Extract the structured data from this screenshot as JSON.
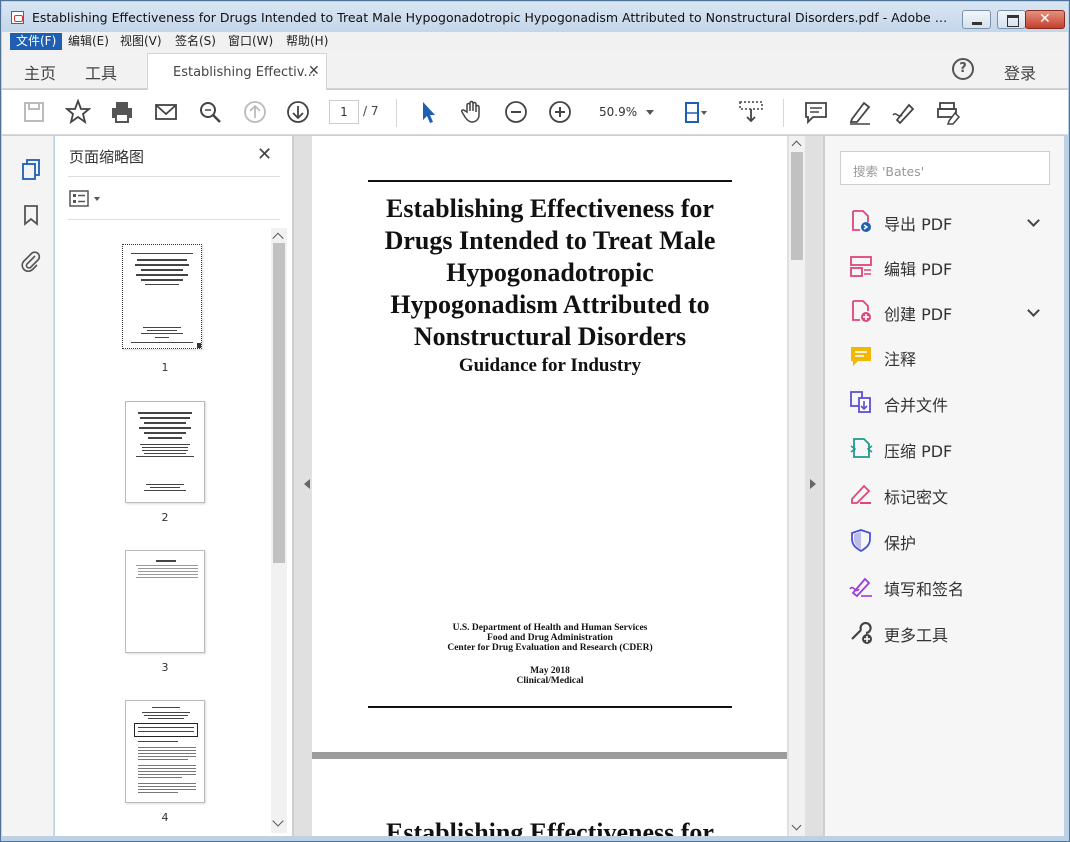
{
  "window": {
    "title": "Establishing Effectiveness for Drugs Intended to Treat Male Hypogonadotropic Hypogonadism Attributed to Nonstructural Disorders.pdf - Adobe Acrobat R...",
    "close_glyph": "✕"
  },
  "menu": {
    "items": [
      "文件(F)",
      "编辑(E)",
      "视图(V)",
      "签名(S)",
      "窗口(W)",
      "帮助(H)"
    ]
  },
  "tabs": {
    "home": "主页",
    "tools": "工具",
    "doc_tab": "Establishing Effectiv...",
    "doc_tab_close": "✕",
    "help": "?",
    "login": "登录"
  },
  "toolbar": {
    "current_page": "1",
    "total_pages": "/ 7",
    "zoom": "50.9%"
  },
  "thumbnails": {
    "title": "页面缩略图",
    "close": "✕",
    "pages": [
      "1",
      "2",
      "3",
      "4"
    ]
  },
  "document": {
    "title_lines": [
      "Establishing Effectiveness for",
      "Drugs Intended to Treat Male",
      "Hypogonadotropic",
      "Hypogonadism Attributed to",
      "Nonstructural Disorders"
    ],
    "subtitle": "Guidance for Industry",
    "publisher_lines": [
      "U.S. Department of Health and Human Services",
      "Food and Drug Administration",
      "Center for Drug Evaluation and Research (CDER)"
    ],
    "date": "May 2018",
    "category": "Clinical/Medical",
    "page2_title": "Establishing Effectiveness for"
  },
  "tools_pane": {
    "search_placeholder": "搜索 'Bates'",
    "tools": [
      {
        "label": "导出 PDF",
        "icon": "export-pdf-icon",
        "color": "#e0457b",
        "expandable": true
      },
      {
        "label": "编辑 PDF",
        "icon": "edit-pdf-icon",
        "color": "#e0457b",
        "expandable": false
      },
      {
        "label": "创建 PDF",
        "icon": "create-pdf-icon",
        "color": "#e0457b",
        "expandable": true
      },
      {
        "label": "注释",
        "icon": "comment-icon",
        "color": "#f2b705",
        "expandable": false
      },
      {
        "label": "合并文件",
        "icon": "combine-files-icon",
        "color": "#5b4fd6",
        "expandable": false
      },
      {
        "label": "压缩 PDF",
        "icon": "compress-pdf-icon",
        "color": "#1f9a8a",
        "expandable": false
      },
      {
        "label": "标记密文",
        "icon": "redact-icon",
        "color": "#e0457b",
        "expandable": false
      },
      {
        "label": "保护",
        "icon": "protect-icon",
        "color": "#4b4fd6",
        "expandable": false
      },
      {
        "label": "填写和签名",
        "icon": "fill-sign-icon",
        "color": "#9b3fd6",
        "expandable": false
      },
      {
        "label": "更多工具",
        "icon": "more-tools-icon",
        "color": "#444444",
        "expandable": false
      }
    ]
  },
  "colors": {
    "menu_active": "#1e5fb3",
    "accent_blue": "#1e5fb3"
  }
}
